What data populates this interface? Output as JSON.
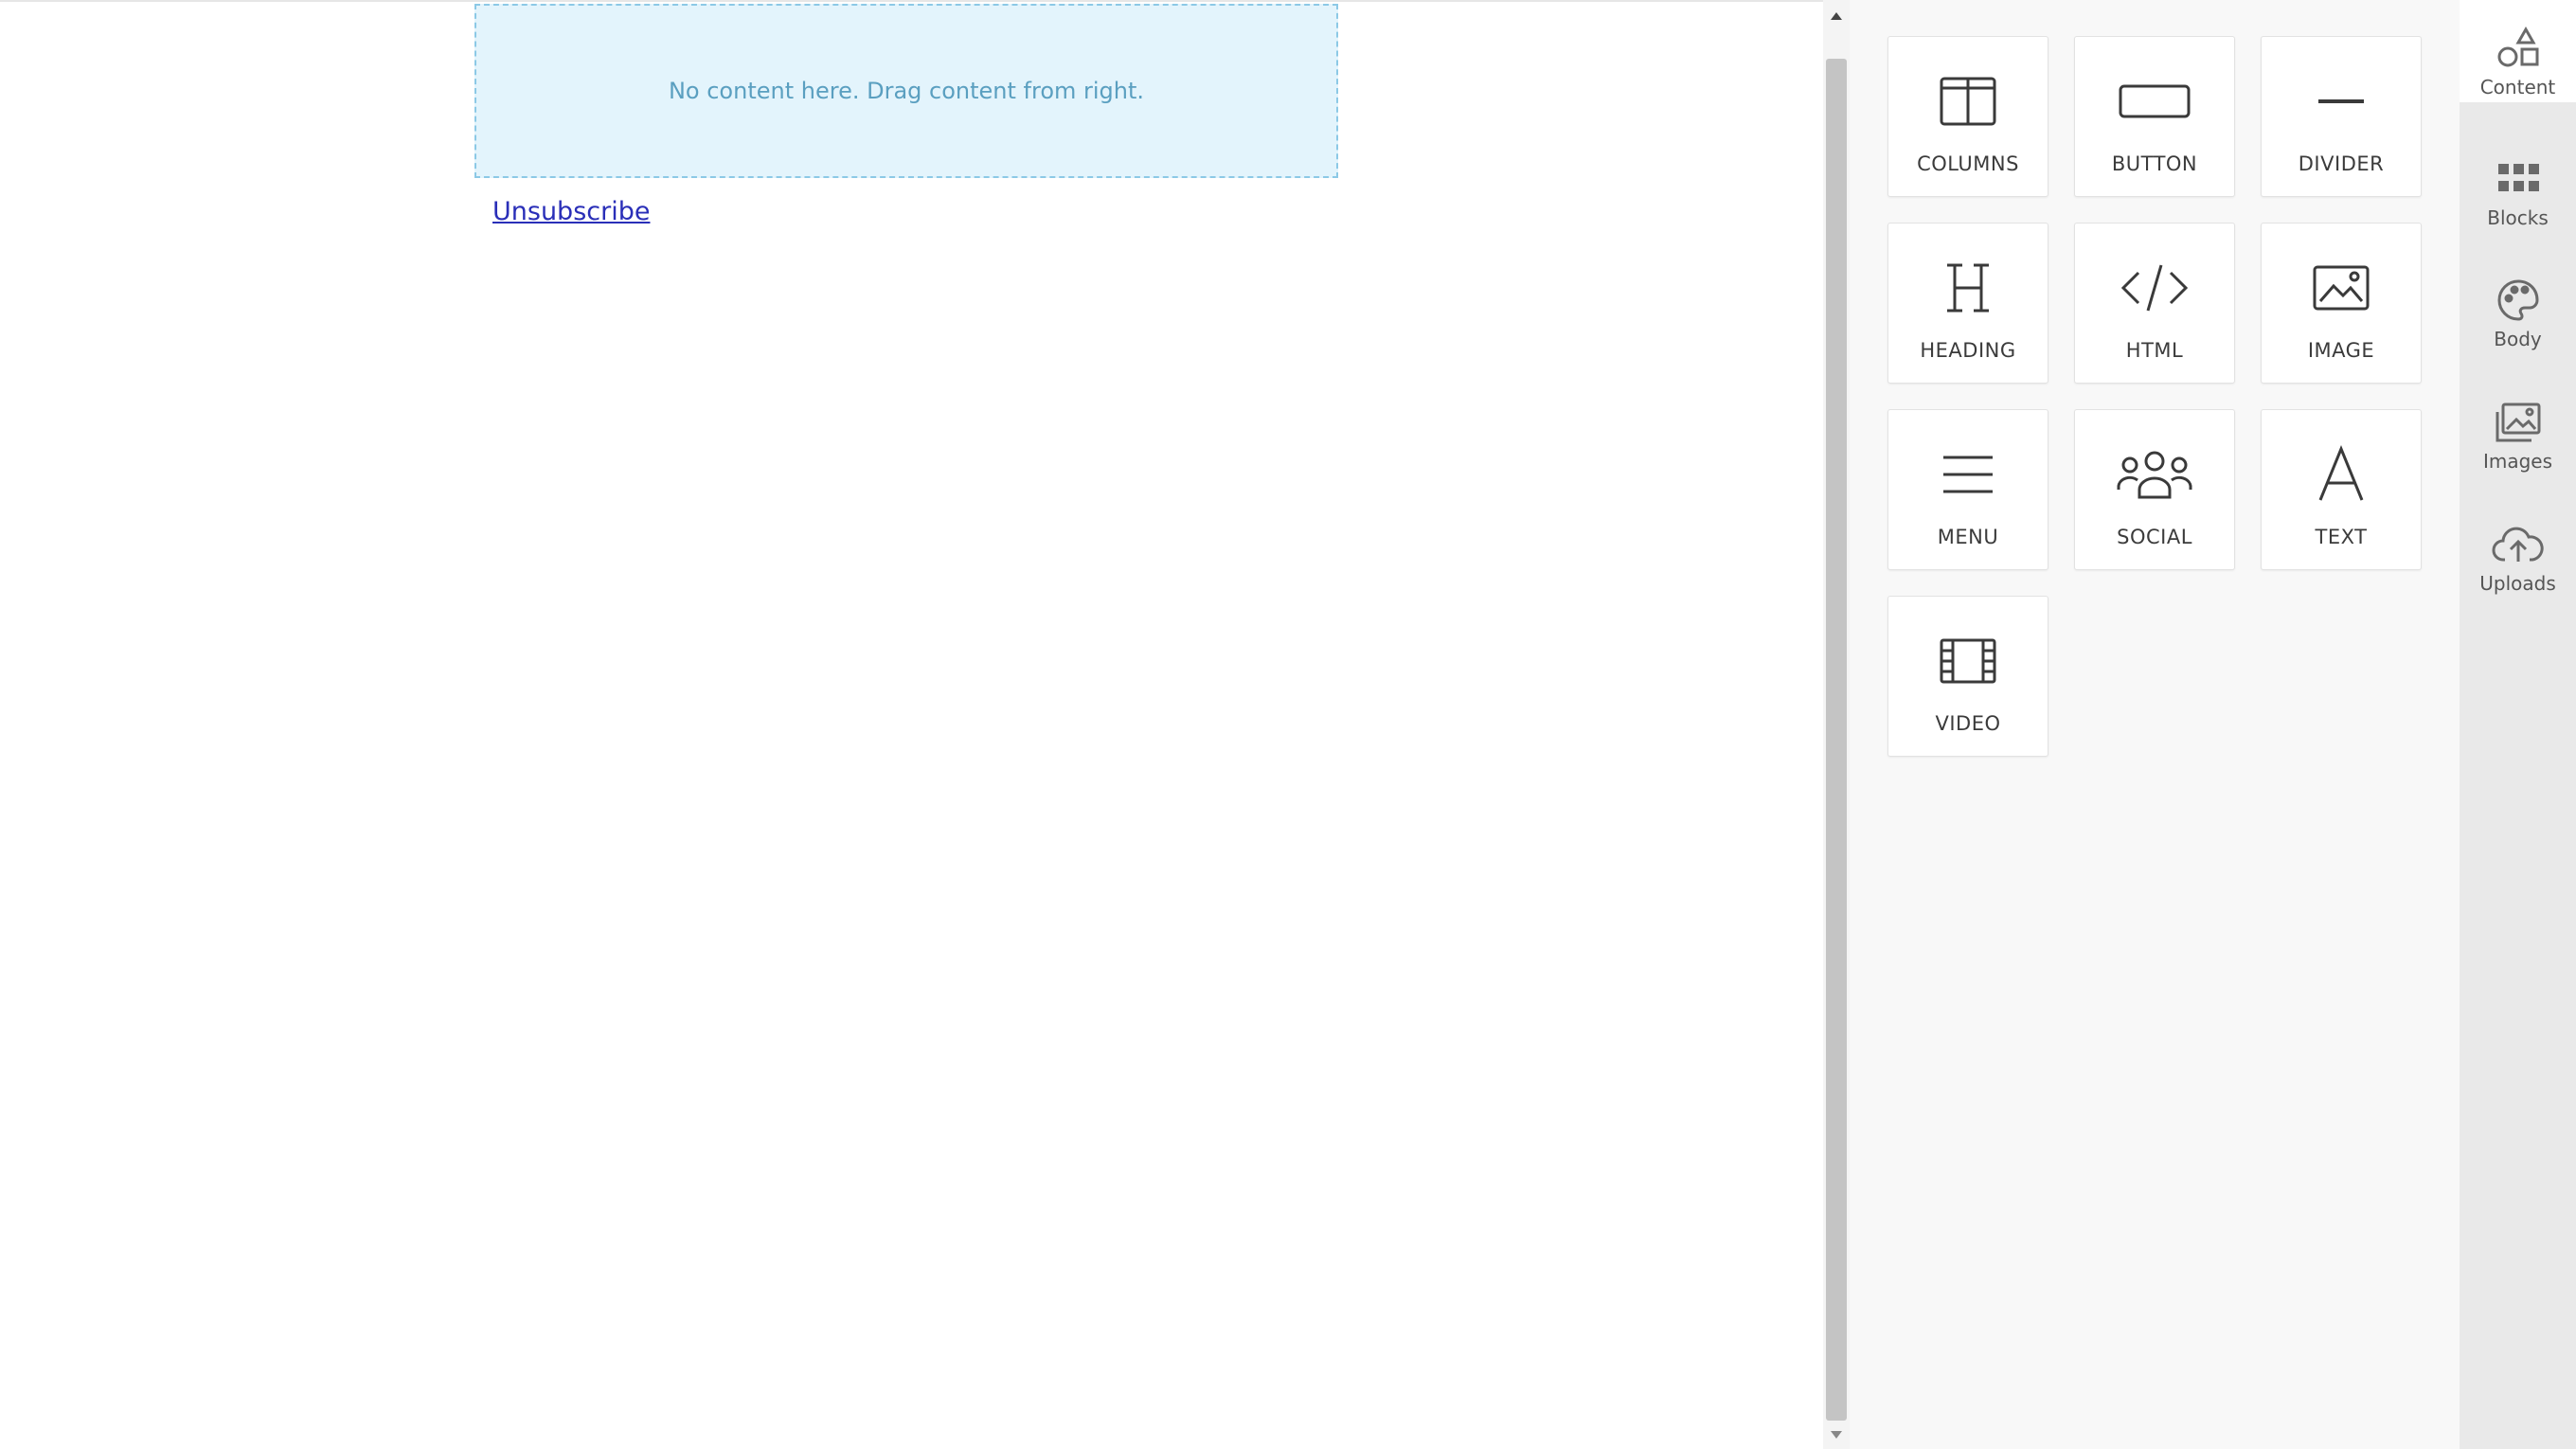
{
  "editor": {
    "dropzone_text": "No content here. Drag content from right.",
    "unsubscribe_link": "Unsubscribe"
  },
  "content_tools": [
    {
      "label": "COLUMNS",
      "icon": "columns-icon"
    },
    {
      "label": "BUTTON",
      "icon": "button-icon"
    },
    {
      "label": "DIVIDER",
      "icon": "divider-icon"
    },
    {
      "label": "HEADING",
      "icon": "heading-icon"
    },
    {
      "label": "HTML",
      "icon": "html-code-icon"
    },
    {
      "label": "IMAGE",
      "icon": "image-icon"
    },
    {
      "label": "MENU",
      "icon": "menu-icon"
    },
    {
      "label": "SOCIAL",
      "icon": "social-icon"
    },
    {
      "label": "TEXT",
      "icon": "text-icon"
    },
    {
      "label": "VIDEO",
      "icon": "video-icon"
    }
  ],
  "sidebar_tabs": [
    {
      "label": "Content",
      "icon": "shapes-icon",
      "active": true
    },
    {
      "label": "Blocks",
      "icon": "blocks-grid-icon",
      "active": false
    },
    {
      "label": "Body",
      "icon": "palette-icon",
      "active": false
    },
    {
      "label": "Images",
      "icon": "images-icon",
      "active": false
    },
    {
      "label": "Uploads",
      "icon": "cloud-upload-icon",
      "active": false
    }
  ],
  "colors": {
    "dropzone_bg": "#e3f4fc",
    "dropzone_border": "#8cc9e6",
    "dropzone_text": "#5a9fc0",
    "link": "#2a2fb8",
    "panel_bg": "#f8f8f8",
    "rail_bg": "#e9e9e9"
  }
}
